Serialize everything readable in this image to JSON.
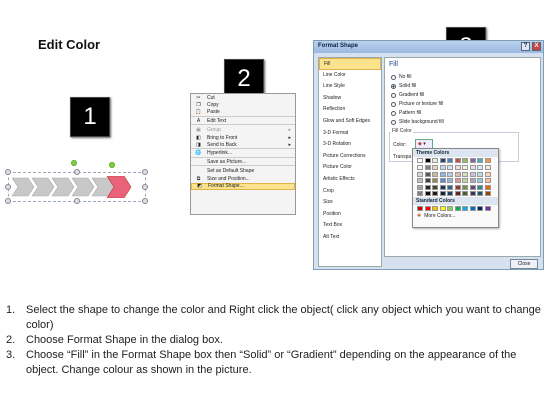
{
  "slide": {
    "title": "Edit Color"
  },
  "badges": [
    "1",
    "2",
    "3"
  ],
  "context_menu": {
    "items": [
      {
        "label": "Cut",
        "icon": "scissors-icon",
        "key": "t"
      },
      {
        "label": "Copy",
        "icon": "copy-icon"
      },
      {
        "label": "Paste",
        "icon": "paste-icon"
      },
      {
        "label": "Edit Text",
        "icon": "edit-text-icon"
      },
      {
        "label": "Group",
        "icon": "group-icon",
        "submenu": true,
        "disabled": true
      },
      {
        "label": "Bring to Front",
        "icon": "bring-front-icon",
        "submenu": true
      },
      {
        "label": "Send to Back",
        "icon": "send-back-icon",
        "submenu": true
      },
      {
        "label": "Hyperlink...",
        "icon": "hyperlink-icon"
      },
      {
        "label": "Save as Picture...",
        "icon": ""
      },
      {
        "label": "Set as Default Shape",
        "icon": ""
      },
      {
        "label": "Size and Position...",
        "icon": "size-icon"
      },
      {
        "label": "Format Shape...",
        "icon": "format-shape-icon",
        "highlight": true
      }
    ]
  },
  "dialog": {
    "title": "Format Shape",
    "help": "?",
    "close": "X",
    "nav": [
      "Fill",
      "Line Color",
      "Line Style",
      "Shadow",
      "Reflection",
      "Glow and Soft Edges",
      "3-D Format",
      "3-D Rotation",
      "Picture Corrections",
      "Picture Color",
      "Artistic Effects",
      "Crop",
      "Size",
      "Position",
      "Text Box",
      "Alt Text"
    ],
    "section": "Fill",
    "options": [
      "No fill",
      "Solid fill",
      "Gradient fill",
      "Picture or texture fill",
      "Pattern fill",
      "Slide background fill"
    ],
    "fill_color_label": "Fill Color",
    "color_label": "Color:",
    "transparency_label": "Transpa",
    "close_button": "Close"
  },
  "palette": {
    "theme_label": "Theme Colors",
    "standard_label": "Standard Colors",
    "more_label": "More Colors...",
    "theme_top": [
      "#ffffff",
      "#000000",
      "#eeece1",
      "#1f497d",
      "#4f81bd",
      "#c0504d",
      "#9bbb59",
      "#8064a2",
      "#4bacc6",
      "#f79646"
    ],
    "theme_shades": [
      [
        "#f2f2f2",
        "#7f7f7f",
        "#ddd9c3",
        "#c6d9f0",
        "#dbe5f1",
        "#f2dcdb",
        "#ebf1dd",
        "#e5e0ec",
        "#dbeef3",
        "#fdeada"
      ],
      [
        "#d8d8d8",
        "#595959",
        "#c4bd97",
        "#8db3e2",
        "#b8cce4",
        "#e5b9b7",
        "#d7e3bc",
        "#ccc1d9",
        "#b7dde8",
        "#fbd5b5"
      ],
      [
        "#bfbfbf",
        "#3f3f3f",
        "#938953",
        "#548dd4",
        "#95b3d7",
        "#d99694",
        "#c3d69b",
        "#b2a2c7",
        "#92cddc",
        "#fac08f"
      ],
      [
        "#a5a5a5",
        "#262626",
        "#494429",
        "#17365d",
        "#366092",
        "#953734",
        "#76923c",
        "#5f497a",
        "#31859b",
        "#e36c09"
      ],
      [
        "#7f7f7f",
        "#0c0c0c",
        "#1d1b10",
        "#0f243e",
        "#244061",
        "#632423",
        "#4f6128",
        "#3f3151",
        "#205867",
        "#974806"
      ]
    ],
    "standard": [
      "#c00000",
      "#ff0000",
      "#ffc000",
      "#ffff00",
      "#92d050",
      "#00b050",
      "#00b0f0",
      "#0070c0",
      "#002060",
      "#7030a0"
    ]
  },
  "instructions": [
    {
      "num": "1.",
      "text": "Select the shape to change the color and Right click the object( click any object which you want to change color)"
    },
    {
      "num": "2.",
      "text": "Choose Format Shape in the dialog box."
    },
    {
      "num": "3.",
      "text": "Choose “Fill” in the Format Shape box then “Solid” or “Gradient” depending on the appearance of the object. Change colour as shown in the picture."
    }
  ],
  "colors": {
    "chevron_gray": "#c8c8c8",
    "chevron_selected": "#e8627a",
    "highlight": "#fbe38e"
  }
}
